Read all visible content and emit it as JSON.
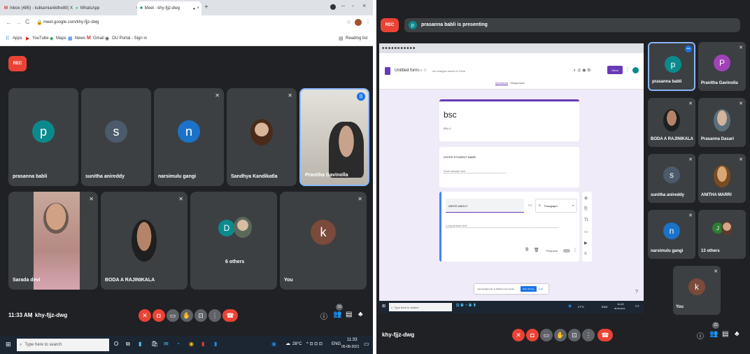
{
  "left": {
    "tabs": [
      {
        "label": "Inbox (485) - kulkarnianikthe80( X"
      },
      {
        "label": "WhatsApp"
      },
      {
        "label": "Meet - khy-fjjz-dwg"
      }
    ],
    "address": "meet.google.com/khy-fjjz-dwg",
    "bookmarks": [
      "Apps",
      "YouTube",
      "Maps",
      "News",
      "Gmail",
      "OU Portal - Sign in"
    ],
    "reading_list": "Reading list",
    "rec": "REC",
    "participants": [
      {
        "name": "prasanna babli",
        "initial": "p",
        "color": "#0b8a8e"
      },
      {
        "name": "sunitha anireddy",
        "initial": "s",
        "color": "#4b5b6b"
      },
      {
        "name": "narsimulu gangi",
        "initial": "n",
        "color": "#1a73c8"
      },
      {
        "name": "Sandhya Kandikatla",
        "initial": "",
        "color": ""
      },
      {
        "name": "Pranitha Gavinolla",
        "initial": "",
        "color": ""
      },
      {
        "name": "Sarada devi",
        "initial": "",
        "color": ""
      },
      {
        "name": "BODA A RAJINIKALA",
        "initial": "",
        "color": ""
      },
      {
        "name": "6 others",
        "initial": "D",
        "color": "#0b8a8e"
      },
      {
        "name": "You",
        "initial": "k",
        "color": "#7a4a3a"
      }
    ],
    "time": "11:33 AM",
    "meeting_code": "khy-fjjz-dwg",
    "participant_count": "16",
    "search_placeholder": "Type here to search",
    "weather": "28°C",
    "lang": "ENG",
    "clock_time": "11:33",
    "clock_date": "05-08-2021"
  },
  "right": {
    "rec": "REC",
    "presenter_initial": "p",
    "presenting": "prasanna babli is presenting",
    "form": {
      "title": "Untitled form",
      "saved": "All changes saved in Drive",
      "send": "Send",
      "tab_questions": "Questions",
      "tab_responses": "Responses",
      "header_title": "bsc",
      "header_desc": "BSc-1",
      "q1": "ENTER STUDENT NAME",
      "q1_hint": "Short answer text",
      "q2": "WRITE ABOUT",
      "q2_type": "Paragraph",
      "q2_hint": "Long answer text",
      "required": "Required",
      "banner": "meet.google.com is sharing your screen",
      "stop": "Stop sharing",
      "hide": "Hide"
    },
    "inner_search": "Type here to search",
    "inner_weather": "27°C",
    "inner_lang": "ENG",
    "inner_time": "11:42",
    "inner_date": "05-08-2021",
    "participants": [
      {
        "name": "prasanna babli",
        "initial": "p",
        "color": "#0b8a8e"
      },
      {
        "name": "Pranitha Gavinolla",
        "initial": "P",
        "color": "#a142b8"
      },
      {
        "name": "BODA A RAJINIKALA",
        "initial": "",
        "color": ""
      },
      {
        "name": "Prasanna Dasari",
        "initial": "",
        "color": ""
      },
      {
        "name": "sunitha anireddy",
        "initial": "s",
        "color": "#4b5b6b"
      },
      {
        "name": "ANITHA MARRI",
        "initial": "",
        "color": ""
      },
      {
        "name": "narsimulu gangi",
        "initial": "n",
        "color": "#1a73c8"
      },
      {
        "name": "13 others",
        "initial": "J",
        "color": "#2e7d32"
      },
      {
        "name": "You",
        "initial": "k",
        "color": "#7a4a3a"
      }
    ],
    "meeting_code": "khy-fjjz-dwg",
    "participant_count": "22"
  }
}
